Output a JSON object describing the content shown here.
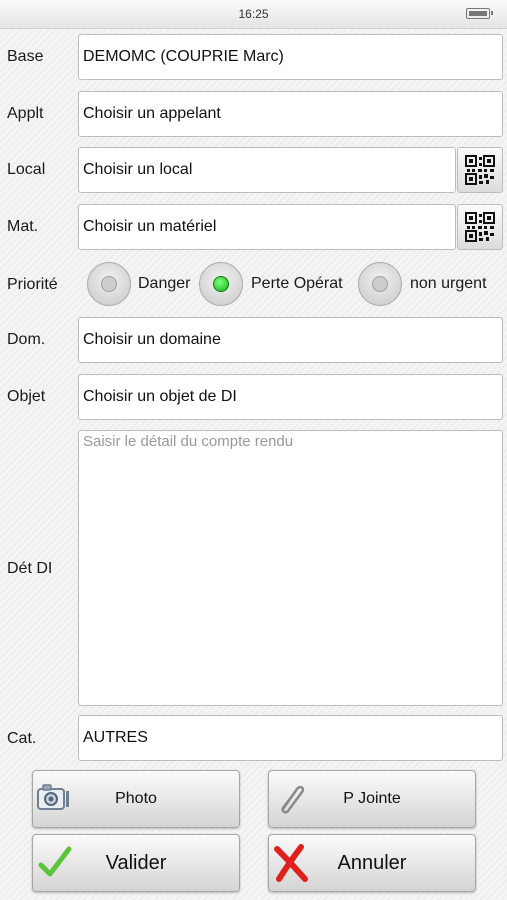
{
  "status_bar": {
    "time": "16:25",
    "battery_icon": "battery-icon"
  },
  "form": {
    "base": {
      "label": "Base",
      "value": "DEMOMC (COUPRIE Marc)"
    },
    "applt": {
      "label": "Applt",
      "value": "Choisir un appelant"
    },
    "local": {
      "label": "Local",
      "value": "Choisir un local",
      "scan_icon": "qr-code-icon"
    },
    "mat": {
      "label": "Mat.",
      "value": "Choisir un matériel",
      "scan_icon": "qr-code-icon"
    },
    "priorite": {
      "label": "Priorité",
      "options": [
        {
          "label": "Danger",
          "selected": false
        },
        {
          "label": "Perte Opérat",
          "selected": true
        },
        {
          "label": "non urgent",
          "selected": false
        }
      ]
    },
    "dom": {
      "label": "Dom.",
      "value": "Choisir un domaine"
    },
    "objet": {
      "label": "Objet",
      "value": "Choisir un objet de DI"
    },
    "det_di": {
      "label": "Dét DI",
      "placeholder": "Saisir le détail du compte rendu"
    },
    "cat": {
      "label": "Cat.",
      "value": "AUTRES"
    }
  },
  "buttons": {
    "photo": {
      "label": "Photo",
      "icon": "camera-icon"
    },
    "p_jointe": {
      "label": "P Jointe",
      "icon": "paperclip-icon"
    },
    "valider": {
      "label": "Valider",
      "icon": "checkmark-icon",
      "icon_color": "#5cc43a"
    },
    "annuler": {
      "label": "Annuler",
      "icon": "cross-icon",
      "icon_color": "#e0201c"
    }
  },
  "colors": {
    "radio_selected": "#11b411"
  }
}
